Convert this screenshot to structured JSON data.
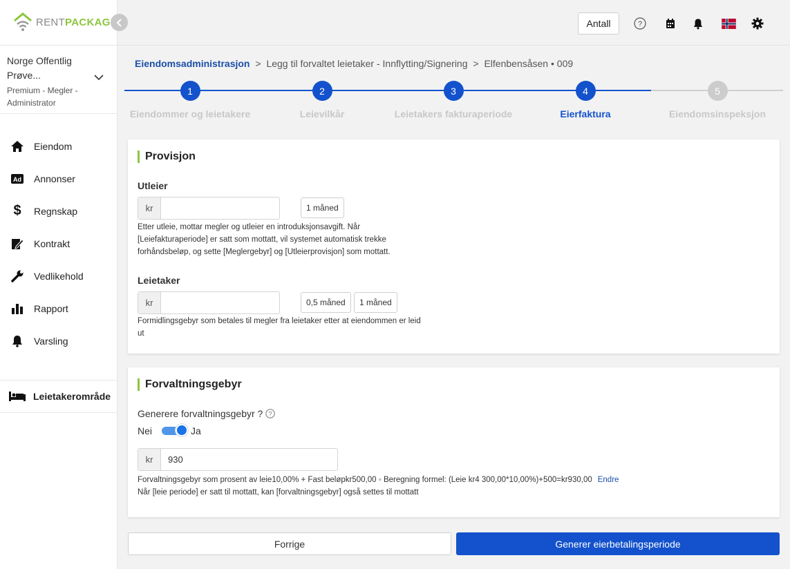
{
  "brand": {
    "rent": "RENT",
    "package": "PACKAGE"
  },
  "account": {
    "name": "Norge Offentlig Prøve...",
    "role": "Premium - Megler - Administrator"
  },
  "nav": [
    {
      "label": "Eiendom",
      "icon": "home-icon"
    },
    {
      "label": "Annonser",
      "icon": "ad-icon"
    },
    {
      "label": "Regnskap",
      "icon": "dollar-icon"
    },
    {
      "label": "Kontrakt",
      "icon": "contract-icon"
    },
    {
      "label": "Vedlikehold",
      "icon": "wrench-icon"
    },
    {
      "label": "Rapport",
      "icon": "bar-chart-icon"
    },
    {
      "label": "Varsling",
      "icon": "bell-icon"
    }
  ],
  "tenant_area": {
    "label": "Leietakerområde",
    "icon": "bed-icon"
  },
  "topbar": {
    "antall": "Antall"
  },
  "breadcrumb": {
    "root": "Eiendomsadministrasjon",
    "separator": ">",
    "middle": "Legg til forvaltet leietaker - Innflytting/Signering",
    "current": "Elfenbensåsen • 009"
  },
  "steps": [
    {
      "num": "1",
      "label": "Eiendommer og leietakere",
      "state": "done"
    },
    {
      "num": "2",
      "label": "Leievilkår",
      "state": "done"
    },
    {
      "num": "3",
      "label": "Leietakers fakturaperiode",
      "state": "done"
    },
    {
      "num": "4",
      "label": "Eierfaktura",
      "state": "active"
    },
    {
      "num": "5",
      "label": "Eiendomsinspeksjon",
      "state": "pending"
    }
  ],
  "provisjon": {
    "title": "Provisjon",
    "utleier": {
      "label": "Utleier",
      "prefix": "kr",
      "value": "",
      "chips": [
        "1 måned"
      ],
      "help_line1": "Etter utleie, mottar megler og utleier en introduksjonsavgift. Når",
      "help_line2": "[Leiefakturaperiode] er satt som mottatt, vil systemet automatisk trekke",
      "help_line3": "forhåndsbeløp, og sette [Meglergebyr] og [Utleierprovisjon] som mottatt."
    },
    "leietaker": {
      "label": "Leietaker",
      "prefix": "kr",
      "value": "",
      "chips": [
        "0,5 måned",
        "1 måned"
      ],
      "help_line1": "Formidlingsgebyr som betales til megler fra leietaker etter at eiendommen er leid",
      "help_line2": "ut"
    }
  },
  "forvaltning": {
    "title": "Forvaltningsgebyr",
    "question": "Generere forvaltningsgebyr ?",
    "toggle_off": "Nei",
    "toggle_on": "Ja",
    "toggle_value": true,
    "prefix": "kr",
    "value": "930",
    "help_line1": "Forvaltningsgebyr som prosent av leie10,00% + Fast beløpkr500,00 ◦ Beregning formel: (Leie kr4 300,00*10,00%)+500=kr930,00",
    "edit": "Endre",
    "help_line2": "Når [leie periode] er satt til mottatt, kan [forvaltningsgebyr] også settes til mottatt"
  },
  "buttons": {
    "prev": "Forrige",
    "next": "Generer eierbetalingsperiode"
  },
  "colors": {
    "accent": "#1352cc",
    "brand_green": "#8cc63f",
    "step_pending": "#cccccc"
  }
}
